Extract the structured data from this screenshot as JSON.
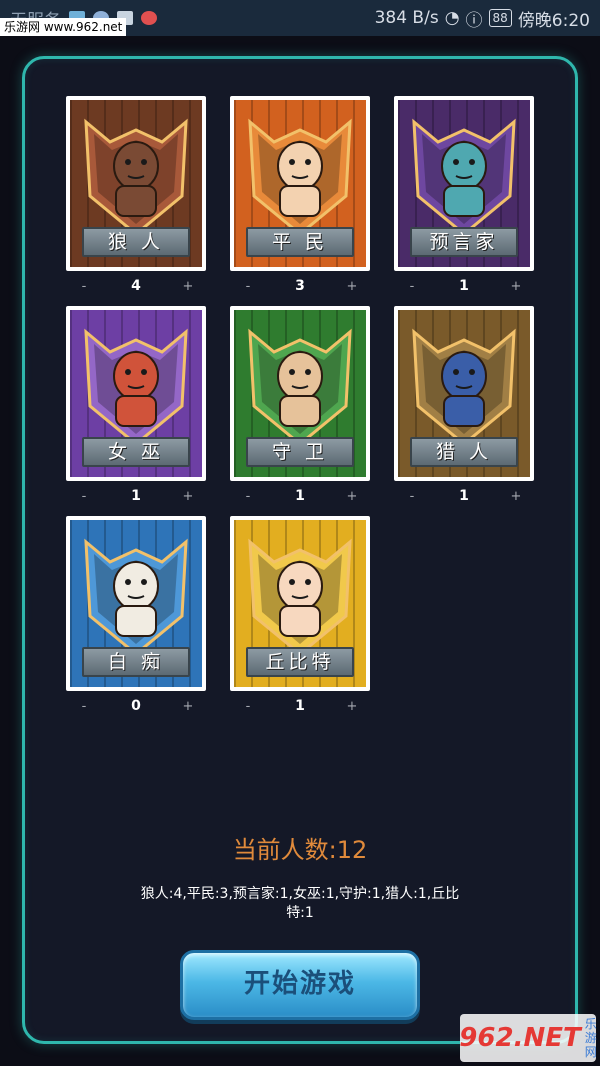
{
  "status_bar": {
    "left_text": "无服务",
    "watermark": "乐游网 www.962.net",
    "speed": "384 B/s",
    "battery": "88",
    "time": "傍晚6:20"
  },
  "cards": [
    {
      "name": "狼 人",
      "count": "4",
      "bg": "#6d3a22",
      "accent": "#a8593a",
      "figure": "#7a4a34"
    },
    {
      "name": "平 民",
      "count": "3",
      "bg": "#d2611f",
      "accent": "#e88a3a",
      "figure": "#f3d2b0"
    },
    {
      "name": "预言家",
      "count": "1",
      "bg": "#4a2b68",
      "accent": "#6e47a0",
      "figure": "#4fa8b0"
    },
    {
      "name": "女 巫",
      "count": "1",
      "bg": "#6d3fa4",
      "accent": "#9467c7",
      "figure": "#d0533a"
    },
    {
      "name": "守 卫",
      "count": "1",
      "bg": "#2f7c2f",
      "accent": "#4fa64f",
      "figure": "#e6c29a"
    },
    {
      "name": "猎 人",
      "count": "1",
      "bg": "#7a5a2a",
      "accent": "#a17f45",
      "figure": "#3a5ea8"
    },
    {
      "name": "白 痴",
      "count": "0",
      "bg": "#2e74b8",
      "accent": "#4e98d8",
      "figure": "#f1ece2"
    },
    {
      "name": "丘比特",
      "count": "1",
      "bg": "#e2ae20",
      "accent": "#f1c94b",
      "figure": "#f7d8bf"
    }
  ],
  "counter_minus": "-",
  "counter_plus": "+",
  "total_label": "当前人数:12",
  "summary": "狼人:4,平民:3,预言家:1,女巫:1,守护:1,猎人:1,丘比特:1",
  "start_button": "开始游戏",
  "watermark_bottom": {
    "big": "962.NET",
    "small": "乐游网"
  }
}
